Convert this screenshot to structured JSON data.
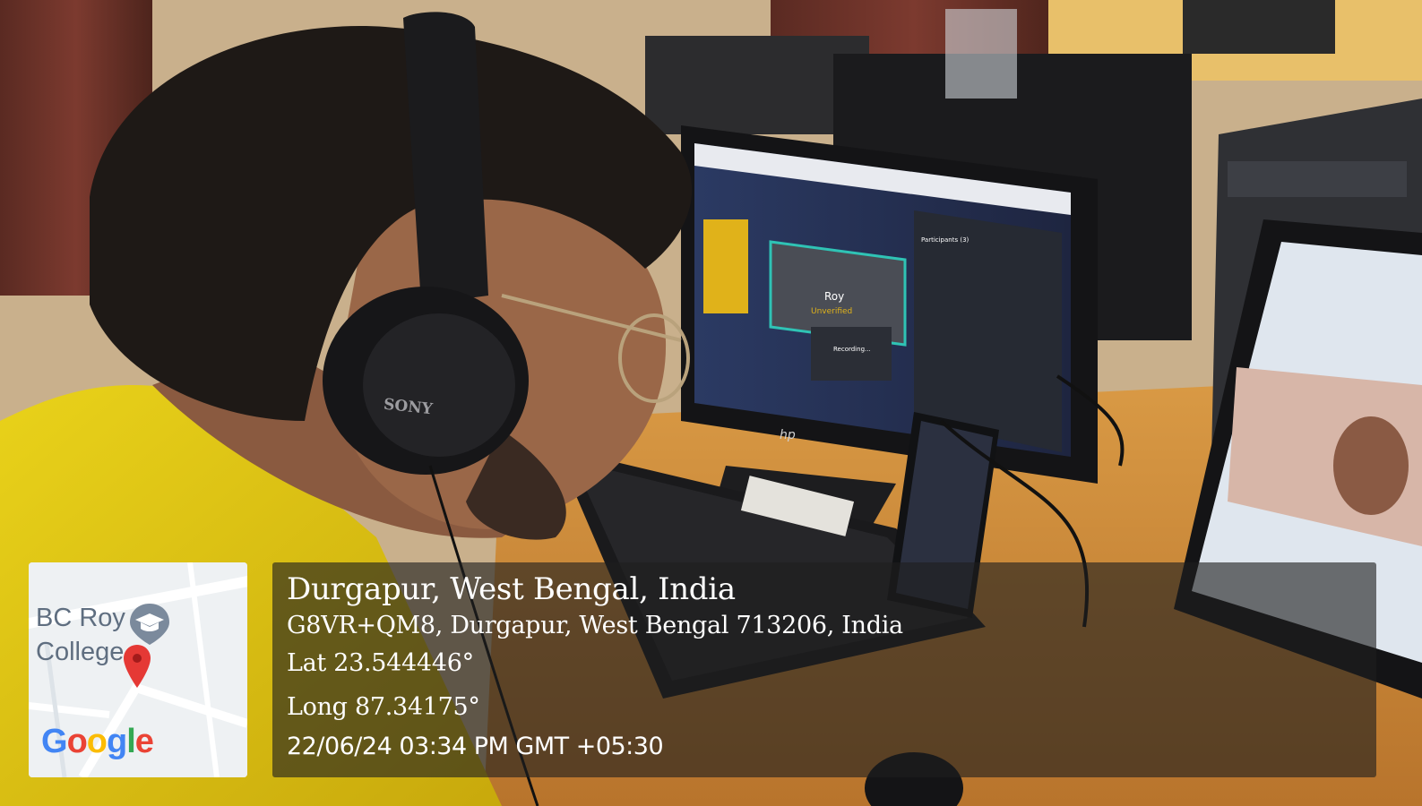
{
  "map": {
    "place_label_line1": "BC Roy",
    "place_label_line2": "College",
    "logo_text": "Google",
    "logo_letters": [
      {
        "char": "G",
        "color": "#4285f4"
      },
      {
        "char": "o",
        "color": "#ea4335"
      },
      {
        "char": "o",
        "color": "#fbbc05"
      },
      {
        "char": "g",
        "color": "#4285f4"
      },
      {
        "char": "l",
        "color": "#34a853"
      },
      {
        "char": "e",
        "color": "#ea4335"
      }
    ],
    "pin_color": "#e53935",
    "icons": [
      "graduation-cap-icon",
      "map-pin-icon"
    ]
  },
  "location": {
    "place": "Durgapur, West Bengal, India",
    "address": "G8VR+QM8, Durgapur, West Bengal 713206, India",
    "latitude": "Lat 23.544446°",
    "longitude": "Long 87.34175°",
    "datetime": "22/06/24 03:34 PM GMT +05:30"
  },
  "scene": {
    "headphone_brand": "SONY",
    "monitor_brand": "hp",
    "screen_participant_name": "Roy",
    "screen_participant_status": "Unverified",
    "screen_recording_text": "Recording...",
    "screen_participants_heading": "Participants (3)"
  }
}
